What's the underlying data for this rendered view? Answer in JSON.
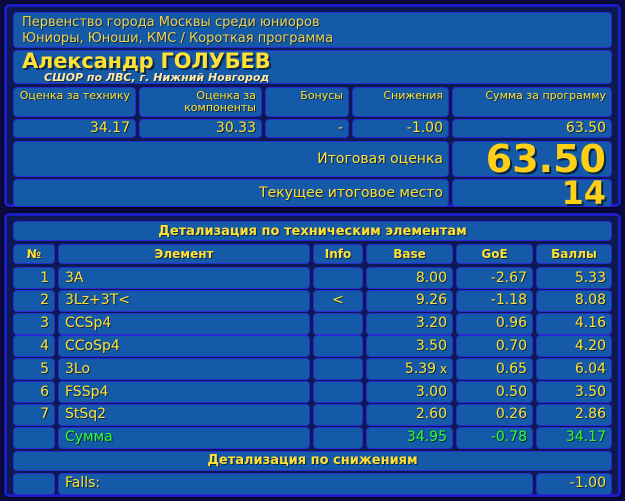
{
  "event": {
    "competition": "Первенство города Москвы среди юниоров",
    "category": "Юниоры, Юноши, КМС / Короткая программа"
  },
  "skater": {
    "name": "Александр ГОЛУБЕВ",
    "club": "СШОР по ЛВС, г. Нижний Новгород"
  },
  "summary": {
    "headers": {
      "tes": "Оценка за технику",
      "pcs": "Оценка за компоненты",
      "bonus": "Бонусы",
      "deductions": "Снижения",
      "total_program": "Сумма за программу"
    },
    "values": {
      "tes": "34.17",
      "pcs": "30.33",
      "bonus": "-",
      "deductions": "-1.00",
      "total_program": "63.50"
    },
    "final_label": "Итоговая оценка",
    "final_value": "63.50",
    "rank_label": "Текущее итоговое место",
    "rank_value": "14"
  },
  "tech": {
    "section_title": "Детализация по техническим элементам",
    "columns": {
      "no": "№",
      "element": "Элемент",
      "info": "Info",
      "base": "Base",
      "goe": "GoE",
      "points": "Баллы"
    },
    "rows": [
      {
        "no": "1",
        "element": "3A",
        "info": "",
        "base": "8.00",
        "base_flag": "",
        "goe": "-2.67",
        "points": "5.33"
      },
      {
        "no": "2",
        "element": "3Lz+3T<",
        "info": "<",
        "base": "9.26",
        "base_flag": "",
        "goe": "-1.18",
        "points": "8.08"
      },
      {
        "no": "3",
        "element": "CCSp4",
        "info": "",
        "base": "3.20",
        "base_flag": "",
        "goe": "0.96",
        "points": "4.16"
      },
      {
        "no": "4",
        "element": "CCoSp4",
        "info": "",
        "base": "3.50",
        "base_flag": "",
        "goe": "0.70",
        "points": "4.20"
      },
      {
        "no": "5",
        "element": "3Lo",
        "info": "",
        "base": "5.39",
        "base_flag": "x",
        "goe": "0.65",
        "points": "6.04"
      },
      {
        "no": "6",
        "element": "FSSp4",
        "info": "",
        "base": "3.00",
        "base_flag": "",
        "goe": "0.50",
        "points": "3.50"
      },
      {
        "no": "7",
        "element": "StSq2",
        "info": "",
        "base": "2.60",
        "base_flag": "",
        "goe": "0.26",
        "points": "2.86"
      }
    ],
    "total": {
      "label": "Сумма",
      "base": "34.95",
      "goe": "-0.78",
      "points": "34.17"
    }
  },
  "deductions": {
    "section_title": "Детализация по снижениям",
    "rows": [
      {
        "label": "Falls:",
        "value": "-1.00"
      }
    ]
  },
  "colors": {
    "background": "#0b0b3f",
    "panel_border": "#1d1dc8",
    "cell_fill": "#155aa8",
    "text_yellow": "#ffe033",
    "text_green": "#2eff2e",
    "big_number": "#ffd016"
  }
}
